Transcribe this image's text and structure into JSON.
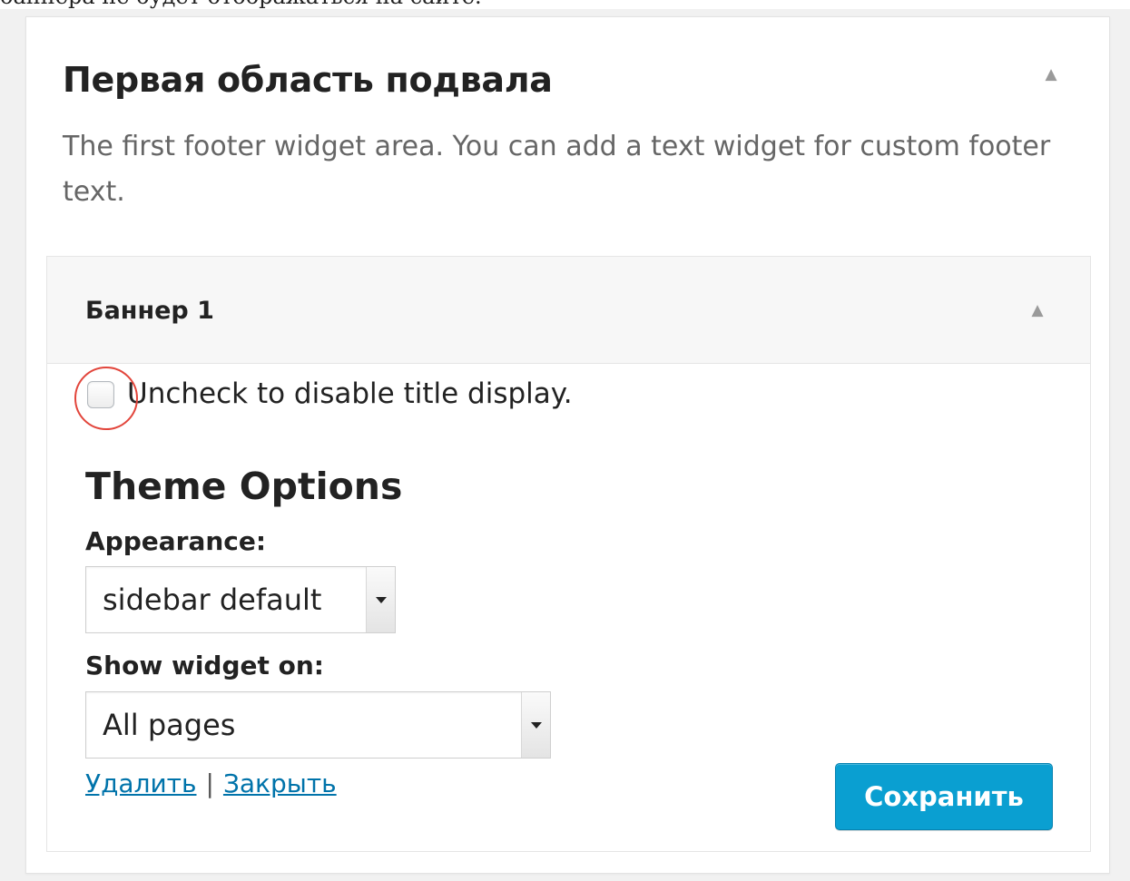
{
  "page": {
    "top_text": "баннера не будет отображаться на сайте."
  },
  "sidebar": {
    "title": "Первая область подвала",
    "description": "The first footer widget area. You can add a text widget for custom footer text.",
    "toggle_icon": "triangle-up-icon"
  },
  "widget": {
    "title": "Баннер 1",
    "toggle_icon": "triangle-up-icon",
    "title_display_checked": false,
    "title_display_label": "Uncheck to disable title display.",
    "highlight_color": "#e2453b",
    "theme_options_heading": "Theme Options",
    "appearance_label": "Appearance:",
    "appearance_value": "sidebar default",
    "show_on_label": "Show widget on:",
    "show_on_value": "All pages",
    "delete_link": "Удалить",
    "separator": "|",
    "close_link": "Закрыть",
    "save_label": "Сохранить"
  },
  "colors": {
    "accent": "#0a9fd1",
    "link": "#0073aa",
    "background": "#f1f1f1"
  }
}
